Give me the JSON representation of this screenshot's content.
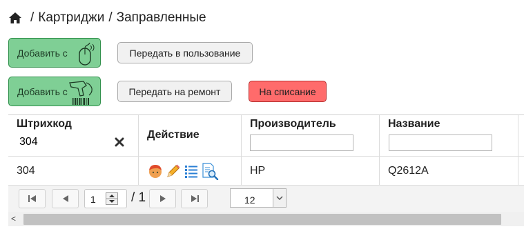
{
  "breadcrumb": {
    "home_icon": "home-icon",
    "separator": "/",
    "items": [
      "Картриджи",
      "Заправленные"
    ]
  },
  "buttons": {
    "add_mouse": {
      "label": "Добавить с",
      "icon": "mouse-icon"
    },
    "add_scanner": {
      "label": "Добавить с",
      "icon": "barcode-scanner-icon"
    },
    "transfer_use": "Передать в пользование",
    "transfer_repair": "Передать на ремонт",
    "write_off": "На списание"
  },
  "colors": {
    "green": "#7fcf95",
    "red": "#ff6b6b"
  },
  "table": {
    "columns": [
      "Штрихкод",
      "Действие",
      "Производитель",
      "Название"
    ],
    "filters": {
      "barcode": "304",
      "manufacturer": "",
      "name": ""
    },
    "rows": [
      {
        "barcode": "304",
        "actions": [
          "user-icon",
          "pencil-icon",
          "list-icon",
          "search-document-icon"
        ],
        "manufacturer": "HP",
        "name": "Q2612A"
      }
    ]
  },
  "pager": {
    "page": "1",
    "total": "/ 1",
    "page_size": "12"
  }
}
